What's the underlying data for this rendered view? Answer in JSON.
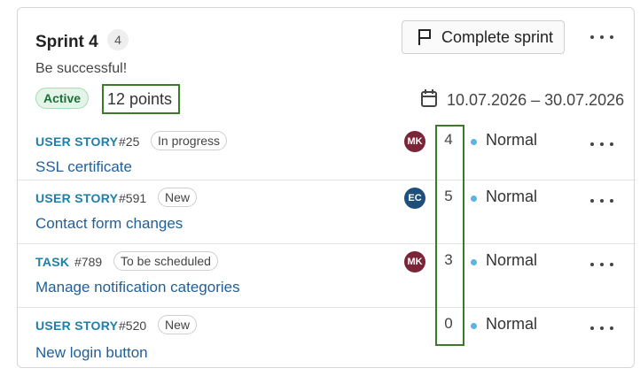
{
  "sprint": {
    "title": "Sprint 4",
    "item_count": "4",
    "goal": "Be successful!",
    "status": "Active",
    "points": "12 points",
    "date_range": "10.07.2026 – 30.07.2026",
    "complete_button_label": "Complete sprint"
  },
  "colors": {
    "active_green": "#1d6f3a",
    "highlight_green": "#3b7a2a",
    "type_blue": "#1f7fa8",
    "title_blue": "#1f5f9a",
    "priority_normal": "#5ab4e6"
  },
  "items": [
    {
      "type": "USER STORY",
      "number": "#25",
      "status": "In progress",
      "title": "SSL certificate",
      "assignee": "MK",
      "assignee_color": "#7a2638",
      "estimate": "4",
      "priority": "Normal"
    },
    {
      "type": "USER STORY",
      "number": "#591",
      "status": "New",
      "title": "Contact form changes",
      "assignee": "EC",
      "assignee_color": "#1d4f7a",
      "estimate": "5",
      "priority": "Normal"
    },
    {
      "type": "TASK",
      "number": "#789",
      "status": "To be scheduled",
      "title": "Manage notification categories",
      "assignee": "MK",
      "assignee_color": "#7a2638",
      "estimate": "3",
      "priority": "Normal"
    },
    {
      "type": "USER STORY",
      "number": "#520",
      "status": "New",
      "title": "New login button",
      "assignee": "",
      "assignee_color": "",
      "estimate": "0",
      "priority": "Normal"
    }
  ]
}
